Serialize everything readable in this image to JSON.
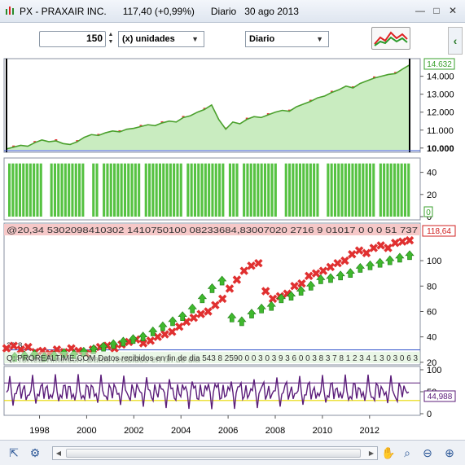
{
  "window": {
    "title": "PX - PRAXAIR INC.      117,40 (+0,99%)      Diario   30 ago 2013",
    "minimize": "—",
    "maximize": "□",
    "close": "✕"
  },
  "toolbar": {
    "quantity_value": "150",
    "units_select": "(x) unidades",
    "period_select": "Diario"
  },
  "colors": {
    "price_line": "#4aa02c",
    "price_fill": "#c9ecc0",
    "price_up": "#e23a3a",
    "bar_green": "#56c242",
    "cross_red": "#e03030",
    "arrow_green": "#3fb82e",
    "oscillator": "#5b1d7a",
    "osc_limit_yellow": "#e8d800",
    "value_box_green": "#3aa02c",
    "value_box_red": "#d02020",
    "header_band": "#f6c8c8"
  },
  "panes": {
    "price": {
      "current_value": "14.632",
      "y_ticks": [
        "14.000",
        "13.000",
        "12.000",
        "11.000",
        "10.000"
      ],
      "y_tick_values": [
        14000,
        13000,
        12000,
        11000,
        10000
      ],
      "y_range": [
        9900,
        14800
      ],
      "series": [
        9950,
        10050,
        10150,
        10100,
        10300,
        10450,
        10350,
        10400,
        10250,
        10200,
        10350,
        10600,
        10750,
        10700,
        10850,
        10950,
        10900,
        11050,
        11100,
        11200,
        11300,
        11250,
        11400,
        11500,
        11450,
        11700,
        11800,
        12000,
        12150,
        12400,
        11600,
        11050,
        11450,
        11350,
        11600,
        11750,
        11700,
        11850,
        12000,
        12100,
        12050,
        12300,
        12450,
        12600,
        12800,
        12900,
        13100,
        13250,
        13450,
        13350,
        13600,
        13750,
        13900,
        14000,
        14100,
        14150,
        14400,
        14632
      ]
    },
    "volume": {
      "current_value": "0",
      "y_ticks": [
        "40",
        "20",
        "0"
      ],
      "y_tick_values": [
        40,
        20,
        0
      ],
      "y_range": [
        0,
        50
      ]
    },
    "signals": {
      "header_band_text": "@20,34  5302098410302 1410750100  08233684,83007020 2716 9 01017 0 0 0 51 737",
      "current_value": "118,64",
      "y_ticks": [
        "100",
        "80",
        "60",
        "40",
        "20"
      ],
      "y_tick_values": [
        100,
        80,
        60,
        40,
        20
      ],
      "y_range": [
        18,
        118
      ],
      "low_line_label": "29,8",
      "low_line_value": 29.8,
      "footer_band_text": "Q: PROREALTIME.COM Datos recibidos en fin de dia   543    8  2590 0 0 3 0 3   9 3 6 0 0 3   8 3 7 8 1 2 3 4 1 3 0 3 0 6 3",
      "watermark": "ProRealTime.com Datos recibidos en fin de dia",
      "red_crosses": [
        31,
        33,
        30,
        32,
        28,
        29,
        27,
        30,
        28,
        31,
        29,
        27,
        30,
        32,
        33,
        31,
        34,
        36,
        38,
        35,
        37,
        40,
        42,
        44,
        48,
        52,
        55,
        58,
        60,
        65,
        70,
        78,
        85,
        92,
        96,
        98,
        76,
        70,
        72,
        74,
        80,
        82,
        88,
        90,
        92,
        95,
        98,
        100,
        105,
        108,
        106,
        110,
        112,
        110,
        114,
        115,
        116
      ],
      "green_arrows": [
        24,
        25,
        26,
        24,
        25,
        27,
        26,
        28,
        30,
        32,
        34,
        36,
        38,
        40,
        44,
        48,
        52,
        56,
        62,
        70,
        78,
        84,
        55,
        52,
        58,
        62,
        64,
        70,
        72,
        76,
        80,
        85,
        86,
        88,
        90,
        94,
        96,
        98,
        100,
        102,
        104
      ]
    },
    "oscillator": {
      "current_value": "44,988",
      "y_ticks": [
        "100",
        "50",
        "0"
      ],
      "y_tick_values": [
        100,
        50,
        0
      ],
      "y_range": [
        0,
        100
      ],
      "upper_line": 70,
      "lower_line": 30
    }
  },
  "x_axis": {
    "labels": [
      "1998",
      "2000",
      "2002",
      "2004",
      "2006",
      "2008",
      "2010",
      "2012"
    ],
    "years": [
      1998,
      2000,
      2002,
      2004,
      2006,
      2008,
      2010,
      2012
    ],
    "range": [
      1996.6,
      2013.7
    ]
  }
}
